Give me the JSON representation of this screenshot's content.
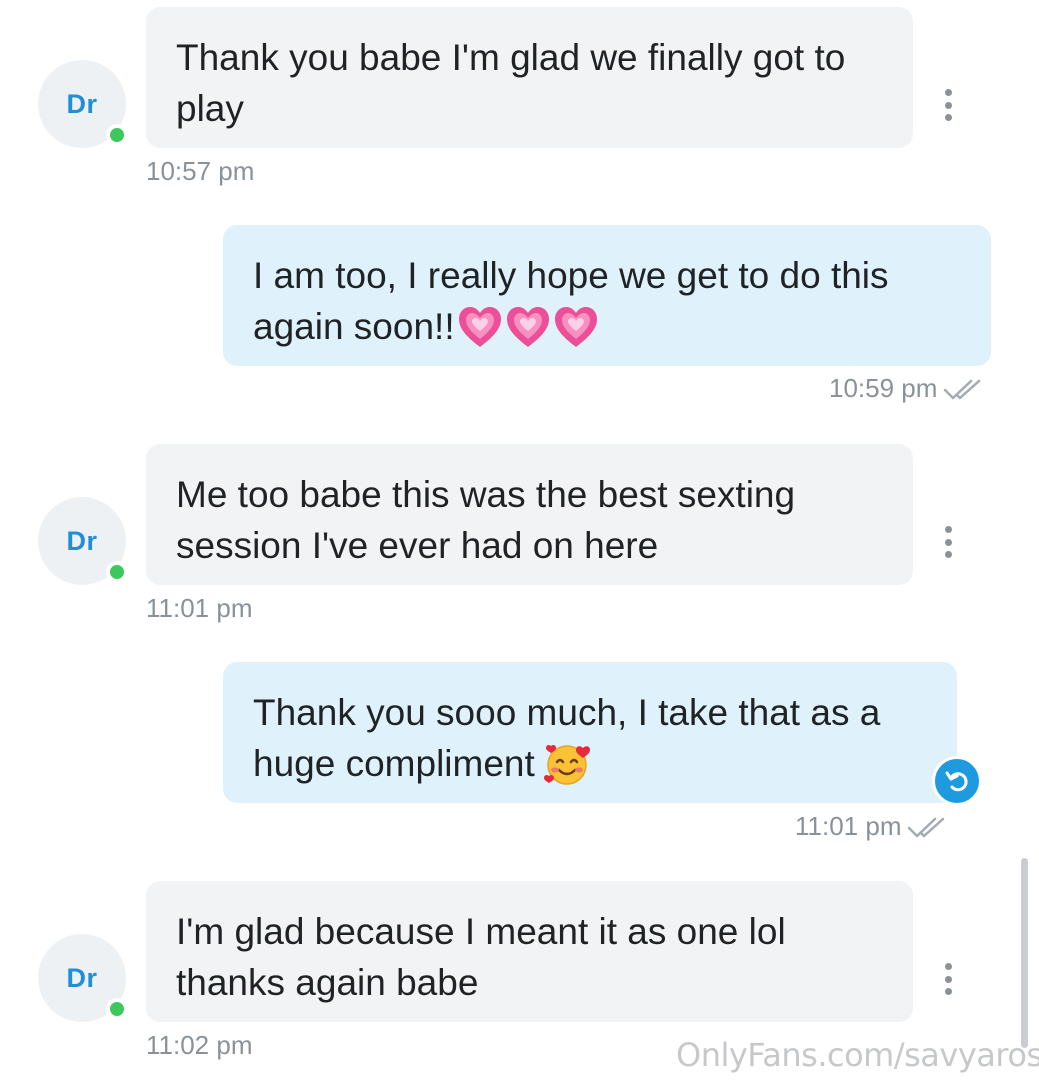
{
  "messages": [
    {
      "direction": "incoming",
      "avatar": "Dr",
      "online": true,
      "lines": [
        "Thank you babe I'm glad we finally got to",
        "play"
      ],
      "time": "10:57 pm",
      "icons": [
        "more-vertical-icon"
      ]
    },
    {
      "direction": "outgoing",
      "lines": [
        "I am too, I really hope we get to do this",
        "again soon!!"
      ],
      "emoji": [
        "growing-heart-emoji",
        "growing-heart-emoji",
        "growing-heart-emoji"
      ],
      "time": "10:59 pm",
      "icons": [
        "double-check-icon"
      ]
    },
    {
      "direction": "incoming",
      "avatar": "Dr",
      "online": true,
      "lines": [
        "Me too babe this was the best sexting",
        "session I've ever had on here"
      ],
      "time": "11:01 pm",
      "icons": [
        "more-vertical-icon"
      ]
    },
    {
      "direction": "outgoing",
      "lines": [
        "Thank you sooo much, I take that as a",
        "huge compliment"
      ],
      "emoji": [
        "smiling-face-with-hearts-emoji"
      ],
      "time": "11:01 pm",
      "icons": [
        "double-check-icon",
        "undo-icon"
      ]
    },
    {
      "direction": "incoming",
      "avatar": "Dr",
      "online": true,
      "lines": [
        "I'm glad because I meant it as one lol",
        "thanks again babe"
      ],
      "time": "11:02 pm",
      "icons": [
        "more-vertical-icon"
      ]
    }
  ],
  "watermark": "OnlyFans.com/savyarose",
  "colors": {
    "incoming_bubble": "#f2f3f5",
    "outgoing_bubble": "#dff2fb",
    "avatar_text": "#1f8fd6",
    "online_dot": "#3cc85a",
    "timestamp": "#8a9299",
    "accent": "#1e9be0"
  }
}
